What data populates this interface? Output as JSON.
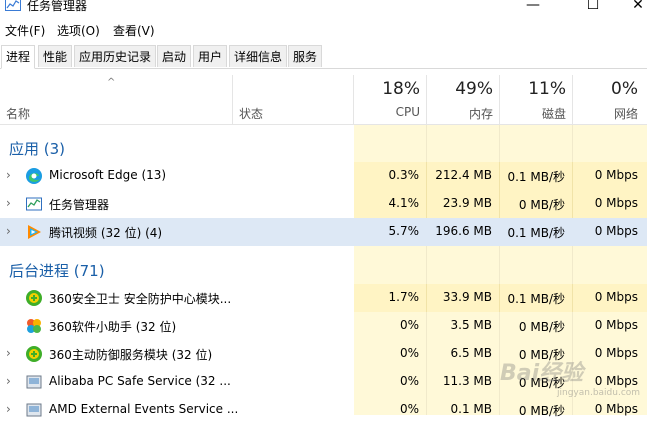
{
  "window": {
    "title": "任务管理器",
    "controls": [
      "—",
      "☐",
      "✕"
    ]
  },
  "menu": [
    "文件(F)",
    "选项(O)",
    "查看(V)"
  ],
  "tabs": [
    "进程",
    "性能",
    "应用历史记录",
    "启动",
    "用户",
    "详细信息",
    "服务"
  ],
  "active_tab": "进程",
  "header": {
    "name": "名称",
    "status": "状态",
    "sort_indicator": "^",
    "cpu": {
      "percent": "18%",
      "label": "CPU"
    },
    "memory": {
      "percent": "49%",
      "label": "内存"
    },
    "disk": {
      "percent": "11%",
      "label": "磁盘"
    },
    "network": {
      "percent": "0%",
      "label": "网络"
    }
  },
  "groups": {
    "apps": {
      "label": "应用 (3)",
      "rows": [
        {
          "name": "Microsoft Edge (13)",
          "cpu": "0.3%",
          "mem": "212.4 MB",
          "disk": "0.1 MB/秒",
          "net": "0 Mbps",
          "icon": "edge-icon"
        },
        {
          "name": "任务管理器",
          "cpu": "4.1%",
          "mem": "23.9 MB",
          "disk": "0 MB/秒",
          "net": "0 Mbps",
          "icon": "task-manager-icon"
        },
        {
          "name": "腾讯视频 (32 位) (4)",
          "cpu": "5.7%",
          "mem": "196.6 MB",
          "disk": "0.1 MB/秒",
          "net": "0 Mbps",
          "icon": "tencent-video-icon"
        }
      ]
    },
    "background": {
      "label": "后台进程 (71)",
      "rows": [
        {
          "name": "360安全卫士 安全防护中心模块...",
          "cpu": "1.7%",
          "mem": "33.9 MB",
          "disk": "0.1 MB/秒",
          "net": "0 Mbps",
          "icon": "360-security-icon"
        },
        {
          "name": "360软件小助手 (32 位)",
          "cpu": "0%",
          "mem": "3.5 MB",
          "disk": "0 MB/秒",
          "net": "0 Mbps",
          "icon": "360-assistant-icon"
        },
        {
          "name": "360主动防御服务模块 (32 位)",
          "cpu": "0%",
          "mem": "6.5 MB",
          "disk": "0 MB/秒",
          "net": "0 Mbps",
          "icon": "360-defense-icon"
        },
        {
          "name": "Alibaba PC Safe Service (32 ...",
          "cpu": "0%",
          "mem": "11.3 MB",
          "disk": "0 MB/秒",
          "net": "0 Mbps",
          "icon": "alibaba-icon"
        },
        {
          "name": "AMD External Events Service ...",
          "cpu": "0%",
          "mem": "0.1 MB",
          "disk": "0 MB/秒",
          "net": "0 Mbps",
          "icon": "amd-icon"
        }
      ]
    }
  },
  "watermark": {
    "text": "Bai经验",
    "sub": "jingyan.baidu.com"
  }
}
